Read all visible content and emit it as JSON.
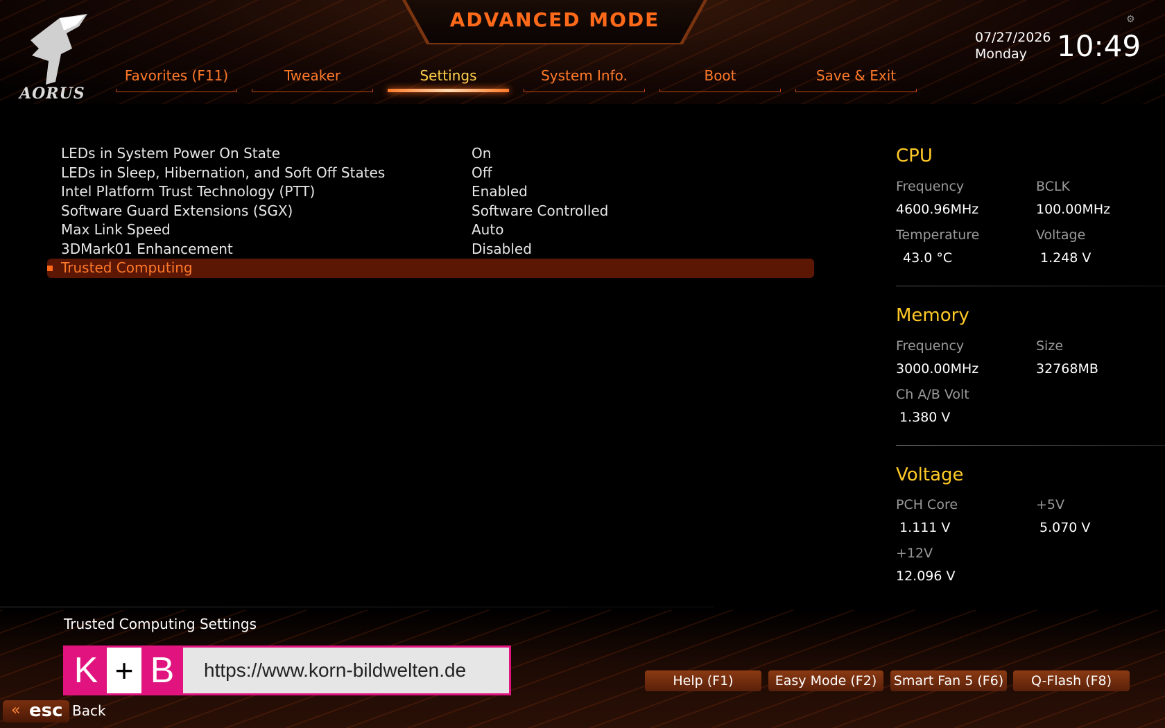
{
  "header": {
    "title": "ADVANCED MODE",
    "brand": "AORUS",
    "date": "07/27/2026",
    "day": "Monday",
    "time": "10:49"
  },
  "tabs": [
    {
      "label": "Favorites (F11)",
      "active": false
    },
    {
      "label": "Tweaker",
      "active": false
    },
    {
      "label": "Settings",
      "active": true
    },
    {
      "label": "System Info.",
      "active": false
    },
    {
      "label": "Boot",
      "active": false
    },
    {
      "label": "Save & Exit",
      "active": false
    }
  ],
  "settings": [
    {
      "label": "LEDs in System Power On State",
      "value": "On"
    },
    {
      "label": "LEDs in Sleep, Hibernation, and Soft Off States",
      "value": "Off"
    },
    {
      "label": "Intel Platform Trust Technology (PTT)",
      "value": "Enabled"
    },
    {
      "label": "Software Guard Extensions (SGX)",
      "value": "Software Controlled"
    },
    {
      "label": "Max Link Speed",
      "value": "Auto"
    },
    {
      "label": "3DMark01 Enhancement",
      "value": "Disabled"
    },
    {
      "label": "Trusted Computing",
      "value": "",
      "selected": true
    }
  ],
  "hw": {
    "cpu": {
      "title": "CPU",
      "freq_label": "Frequency",
      "freq": "4600.96MHz",
      "bclk_label": "BCLK",
      "bclk": "100.00MHz",
      "temp_label": "Temperature",
      "temp": "43.0 °C",
      "volt_label": "Voltage",
      "volt": "1.248 V"
    },
    "memory": {
      "title": "Memory",
      "freq_label": "Frequency",
      "freq": "3000.00MHz",
      "size_label": "Size",
      "size": "32768MB",
      "chvolt_label": "Ch A/B Volt",
      "chvolt": "1.380 V"
    },
    "voltage": {
      "title": "Voltage",
      "pch_label": "PCH Core",
      "pch": "1.111 V",
      "p5v_label": "+5V",
      "p5v": "5.070 V",
      "p12v_label": "+12V",
      "p12v": "12.096 V"
    }
  },
  "description": "Trusted Computing Settings",
  "watermark": {
    "k": "K",
    "plus": "+",
    "b": "B",
    "url": "https://www.korn-bildwelten.de"
  },
  "function_keys": [
    "Help (F1)",
    "Easy Mode (F2)",
    "Smart Fan 5 (F6)",
    "Q-Flash (F8)"
  ],
  "esc": {
    "key": "esc",
    "label": "Back"
  },
  "colors": {
    "accent": "#ff6a1a",
    "active_tab": "#ffd24a",
    "hw_title": "#ffc928",
    "selected_row": "#5c1604",
    "watermark": "#e0137f"
  }
}
